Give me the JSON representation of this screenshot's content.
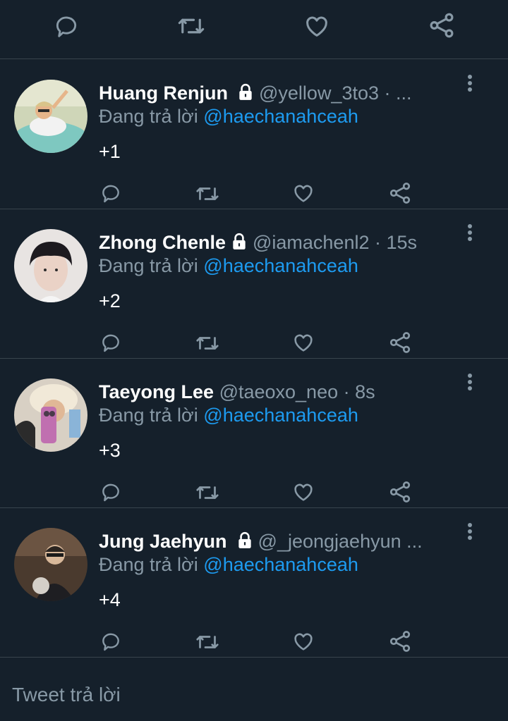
{
  "top_actions": {
    "icons": [
      "reply-icon",
      "retweet-icon",
      "like-icon",
      "share-icon"
    ]
  },
  "reply_prefix": "Đang trả lời",
  "tweets": [
    {
      "name": "Huang Renjun",
      "protected": true,
      "handle": "@yellow_3to3 · ...",
      "reply_to": "@haechanahceah",
      "text": "+1"
    },
    {
      "name": "Zhong Chenle",
      "protected": true,
      "handle": "@iamachenl2 · 15s",
      "reply_to": "@haechanahceah",
      "text": "+2"
    },
    {
      "name": "Taeyong Lee",
      "protected": false,
      "handle": "@taeoxo_neo · 8s",
      "reply_to": "@haechanahceah",
      "text": "+3"
    },
    {
      "name": "Jung Jaehyun",
      "protected": true,
      "handle": "@_jeongjaehyun ...",
      "reply_to": "@haechanahceah",
      "text": "+4"
    }
  ],
  "composer": {
    "placeholder": "Tweet trả lời"
  },
  "colors": {
    "background": "#15202b",
    "divider": "#38444d",
    "secondary_text": "#8899a6",
    "link": "#1d9bf0"
  }
}
